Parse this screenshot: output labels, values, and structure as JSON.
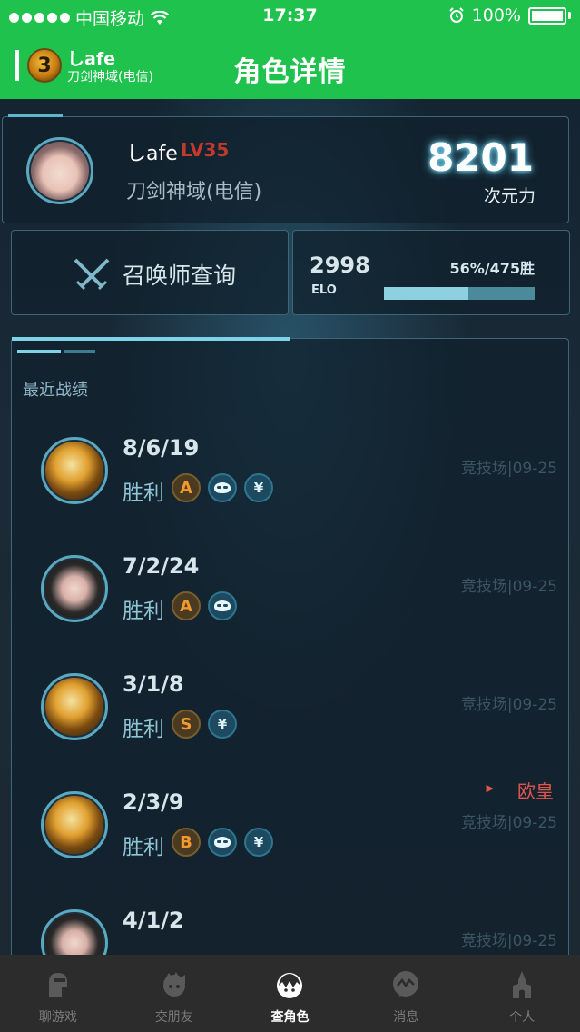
{
  "status_bar": {
    "carrier": "中国移动",
    "time": "17:37",
    "battery": "100%"
  },
  "nav": {
    "badge_level": "3",
    "name": "しafe",
    "server": "刀剑神域(电信)",
    "title": "角色详情"
  },
  "profile": {
    "name": "しafe",
    "level": "LV35",
    "server": "刀剑神域(电信)",
    "power_value": "8201",
    "power_label": "次元力"
  },
  "query": {
    "label": "召唤师查询"
  },
  "elo": {
    "value": "2998",
    "label": "ELO",
    "rate": "56%/475胜",
    "win_fraction": 0.56
  },
  "records": {
    "title": "最近战绩",
    "items": [
      {
        "kda": "8/6/19",
        "result": "胜利",
        "grade": "A",
        "mvp_mask": true,
        "yen": "¥",
        "mode": "竞技场|09-25",
        "hero": "gold",
        "tag": ""
      },
      {
        "kda": "7/2/24",
        "result": "胜利",
        "grade": "A",
        "mvp_mask": true,
        "yen": "",
        "mode": "竞技场|09-25",
        "hero": "dark",
        "tag": ""
      },
      {
        "kda": "3/1/8",
        "result": "胜利",
        "grade": "S",
        "mvp_mask": false,
        "yen": "¥",
        "mode": "竞技场|09-25",
        "hero": "gold",
        "tag": ""
      },
      {
        "kda": "2/3/9",
        "result": "胜利",
        "grade": "B",
        "mvp_mask": true,
        "yen": "¥",
        "mode": "竞技场|09-25",
        "hero": "gold",
        "tag": "欧皇"
      },
      {
        "kda": "4/1/2",
        "result": "",
        "grade": "",
        "mvp_mask": false,
        "yen": "",
        "mode": "竞技场|09-25",
        "hero": "dark",
        "tag": ""
      }
    ]
  },
  "tabs": [
    {
      "label": "聊游戏",
      "icon": "game-chat-icon",
      "active": false
    },
    {
      "label": "交朋友",
      "icon": "friends-icon",
      "active": false
    },
    {
      "label": "查角色",
      "icon": "character-icon",
      "active": true
    },
    {
      "label": "消息",
      "icon": "message-icon",
      "active": false
    },
    {
      "label": "个人",
      "icon": "castle-icon",
      "active": false
    }
  ],
  "colors": {
    "brand_green": "#1fc24d",
    "level_red": "#c0392b",
    "glow_cyan": "#6fd5f5",
    "tag_red": "#e0554e"
  }
}
